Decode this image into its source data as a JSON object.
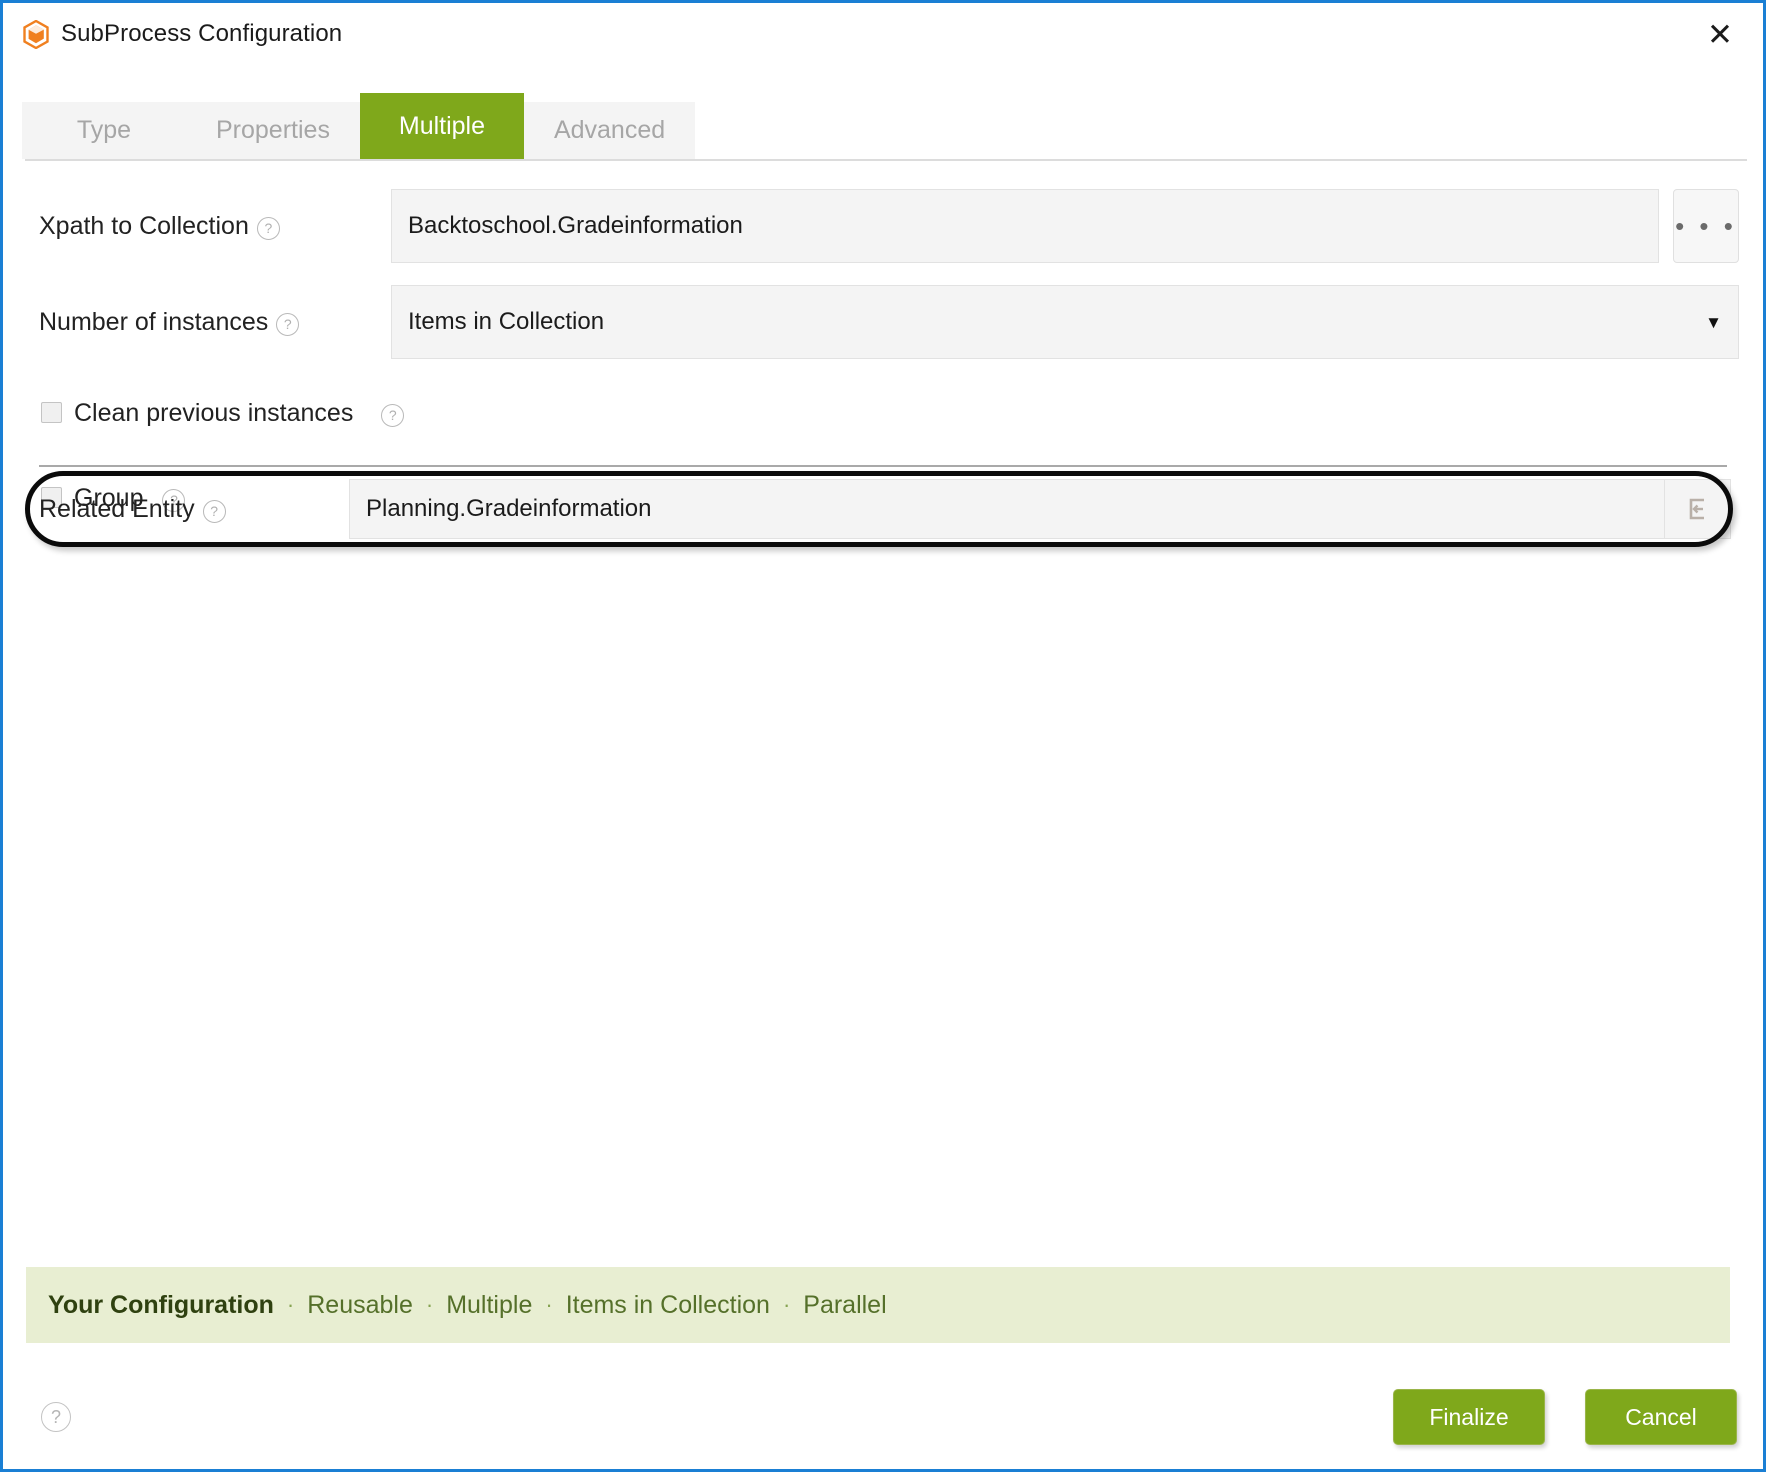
{
  "window": {
    "title": "SubProcess Configuration",
    "logo_icon": "mendix-cube-icon",
    "close_icon": "close-icon",
    "close_glyph": "✕",
    "accent_blue": "#1a7fd4",
    "accent_green": "#7fa81b",
    "logo_orange": "#f08020"
  },
  "tabs": [
    {
      "label": "Type",
      "active": false
    },
    {
      "label": "Properties",
      "active": false
    },
    {
      "label": "Multiple",
      "active": true
    },
    {
      "label": "Advanced",
      "active": false
    }
  ],
  "form": {
    "xpath": {
      "label": "Xpath to Collection",
      "help_glyph": "?",
      "value": "Backtoschool.Gradeinformation",
      "browse_label": "• • •",
      "browse_icon": "ellipsis-icon"
    },
    "instances": {
      "label": "Number of instances",
      "help_glyph": "?",
      "value": "Items in Collection",
      "caret_glyph": "▼",
      "options": [
        "Items in Collection"
      ]
    },
    "clean_previous": {
      "label": "Clean previous instances",
      "checked": false,
      "help_glyph": "?"
    },
    "group": {
      "label": "Group",
      "checked": false,
      "help_glyph": "?"
    },
    "related_entity": {
      "label": "Related Entity",
      "help_glyph": "?",
      "value": "Planning.Gradeinformation",
      "button_icon": "select-association-icon"
    }
  },
  "summary": {
    "title": "Your Configuration",
    "separator": "·",
    "items": [
      "Reusable",
      "Multiple",
      "Items in Collection",
      "Parallel"
    ]
  },
  "footer": {
    "help_glyph": "?",
    "help_icon": "help-circle-icon",
    "finalize_label": "Finalize",
    "cancel_label": "Cancel"
  }
}
